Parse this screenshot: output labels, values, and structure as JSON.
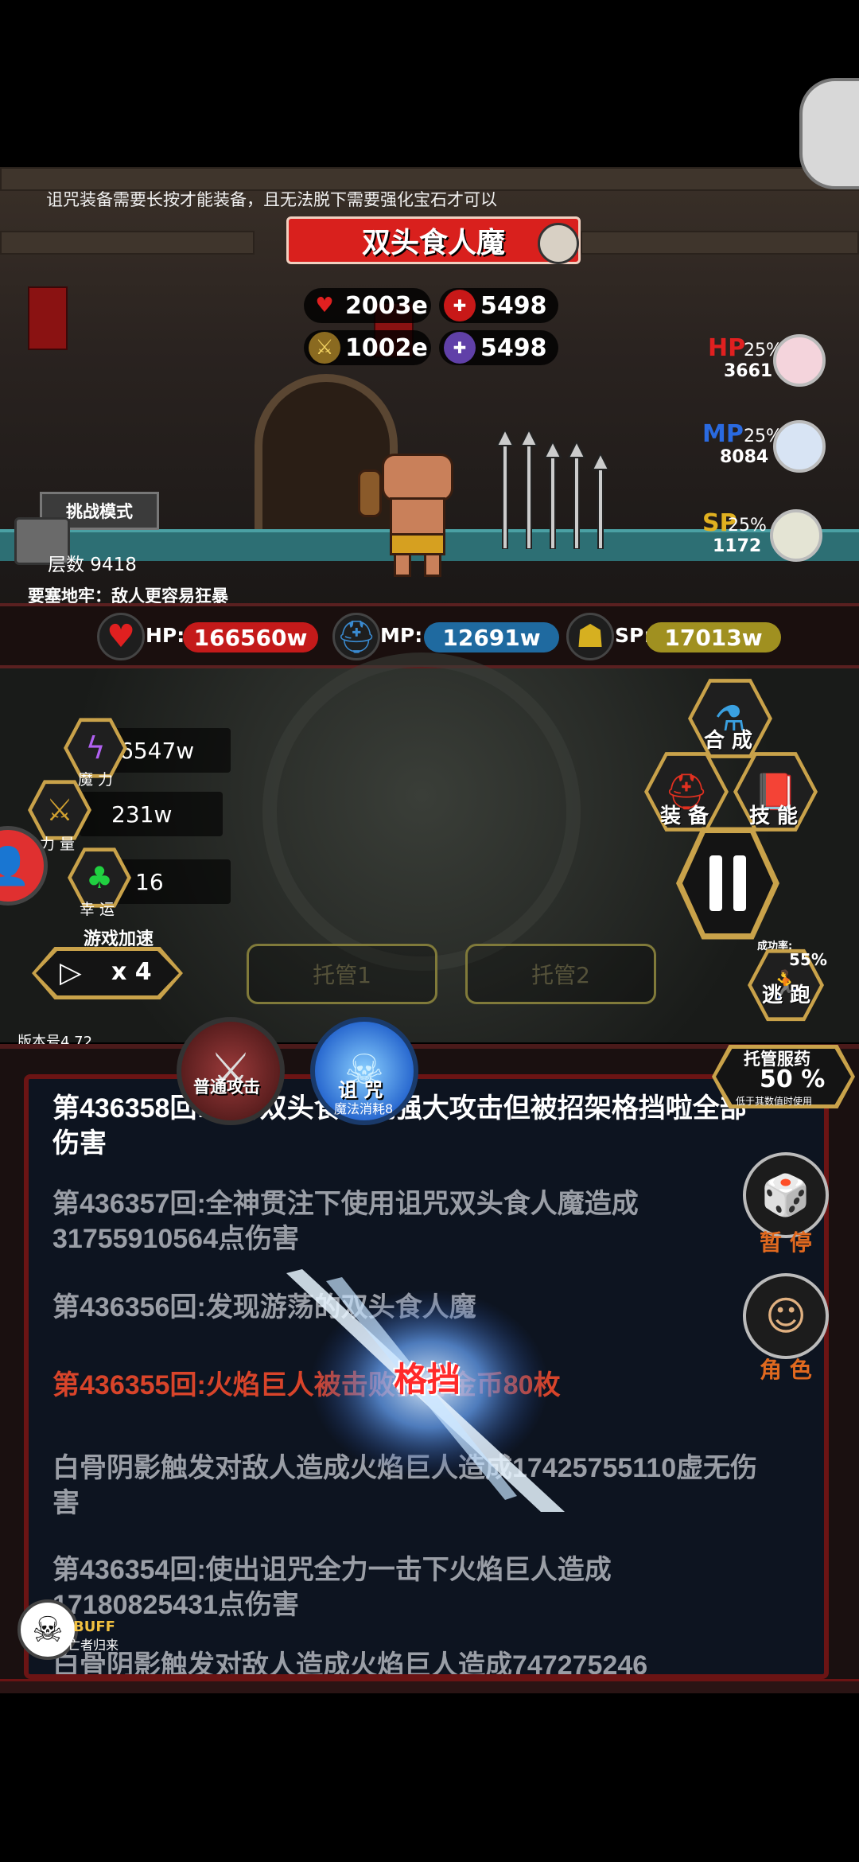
{
  "tip": "诅咒装备需要长按才能装备，且无法脱下需要强化宝石才可以",
  "boss": {
    "name": "双头食人魔",
    "hp": "2003e",
    "def": "5498",
    "atk": "1002e",
    "mdef": "5498"
  },
  "potions": [
    {
      "label": "HP",
      "pct": "25%",
      "value": "3661",
      "color": "#e02020"
    },
    {
      "label": "MP",
      "pct": "25%",
      "value": "8084",
      "color": "#2a6ae0"
    },
    {
      "label": "SP",
      "pct": "25%",
      "value": "1172",
      "color": "#e0b020"
    }
  ],
  "challenge_mode": "挑战模式",
  "layers": "层数 9418",
  "dungeon_note": "要塞地牢：敌人更容易狂暴",
  "player": {
    "hp_label": "HP:",
    "hp": "166560w",
    "mp_label": "MP:",
    "mp": "12691w",
    "sp_label": "SP:",
    "sp": "17013w"
  },
  "attributes": [
    {
      "label": "魔 力",
      "value": "6547w",
      "icon": "lightning-icon"
    },
    {
      "label": "力 量",
      "value": "231w",
      "icon": "sword-icon"
    },
    {
      "label": "幸 运",
      "value": "16",
      "icon": "clover-icon"
    }
  ],
  "menu": {
    "compose": "合 成",
    "equip": "装 备",
    "skill": "技 能"
  },
  "speed": {
    "title": "游戏加速",
    "value": "x 4"
  },
  "auto": [
    "托管1",
    "托管2"
  ],
  "escape": {
    "rate_label": "成功率:",
    "rate": "55%",
    "label": "逃 跑"
  },
  "version": "版本号4.72",
  "attack_buttons": {
    "normal": "普通攻击",
    "curse": "诅 咒",
    "curse_cost": "魔法消耗8"
  },
  "potion_auto": {
    "title": "托管服药",
    "pct": "50 %",
    "sub": "低于其数值时使用"
  },
  "side_buttons": {
    "pause": "暂 停",
    "role": "角 色"
  },
  "log": [
    {
      "text": "第436358回:面对双头食人魔强大攻击但被招架格挡啦全部伤害",
      "style": "white"
    },
    {
      "text": "第436357回:全神贯注下使用诅咒双头食人魔造成31755910564点伤害",
      "style": "gray"
    },
    {
      "text": "第436356回:发现游荡的双头食人魔",
      "style": "gray"
    },
    {
      "text": "第436355回:火焰巨人被击败获得金币80枚",
      "style": "red"
    },
    {
      "text": "白骨阴影触发对敌人造成火焰巨人造成17425755110虚无伤害",
      "style": "gray"
    },
    {
      "text": "第436354回:使出诅咒全力一击下火焰巨人造成17180825431点伤害",
      "style": "gray"
    },
    {
      "text": "白骨阴影触发对敌人造成火焰巨人造成747275246",
      "style": "gray"
    }
  ],
  "block_effect": "格挡",
  "buff": {
    "label": "BUFF",
    "name": "亡者归来"
  }
}
